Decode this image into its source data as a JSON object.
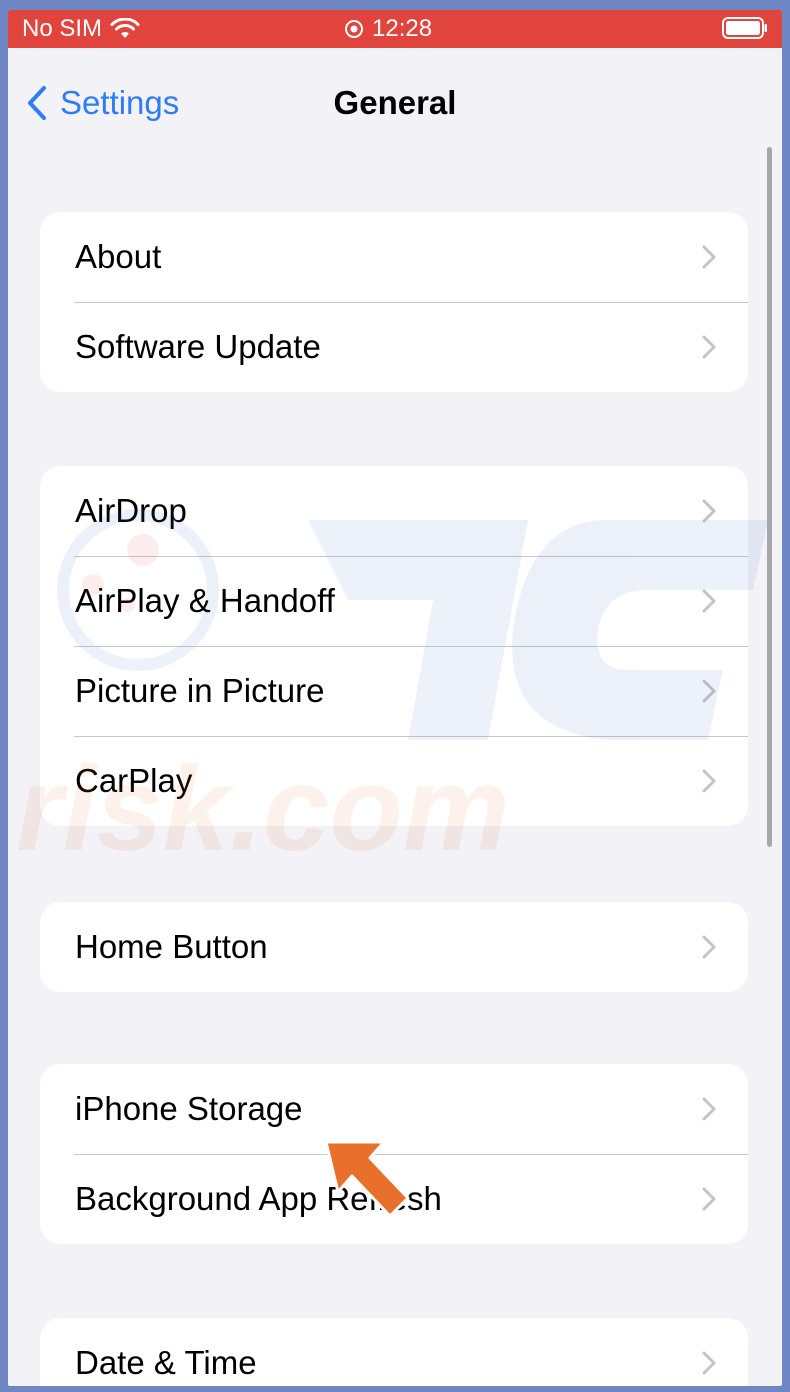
{
  "status_bar": {
    "carrier": "No SIM",
    "time": "12:28",
    "accent": "#e0443c"
  },
  "nav": {
    "back_label": "Settings",
    "title": "General"
  },
  "groups": [
    {
      "items": [
        {
          "label": "About"
        },
        {
          "label": "Software Update"
        }
      ]
    },
    {
      "items": [
        {
          "label": "AirDrop"
        },
        {
          "label": "AirPlay & Handoff"
        },
        {
          "label": "Picture in Picture"
        },
        {
          "label": "CarPlay"
        }
      ]
    },
    {
      "items": [
        {
          "label": "Home Button"
        }
      ]
    },
    {
      "items": [
        {
          "label": "iPhone Storage"
        },
        {
          "label": "Background App Refresh"
        }
      ]
    },
    {
      "items": [
        {
          "label": "Date & Time"
        }
      ]
    }
  ],
  "watermark": {
    "text": "risk.com"
  },
  "colors": {
    "link": "#2f7cf6",
    "background": "#f2f2f7",
    "arrow": "#e8702a"
  }
}
